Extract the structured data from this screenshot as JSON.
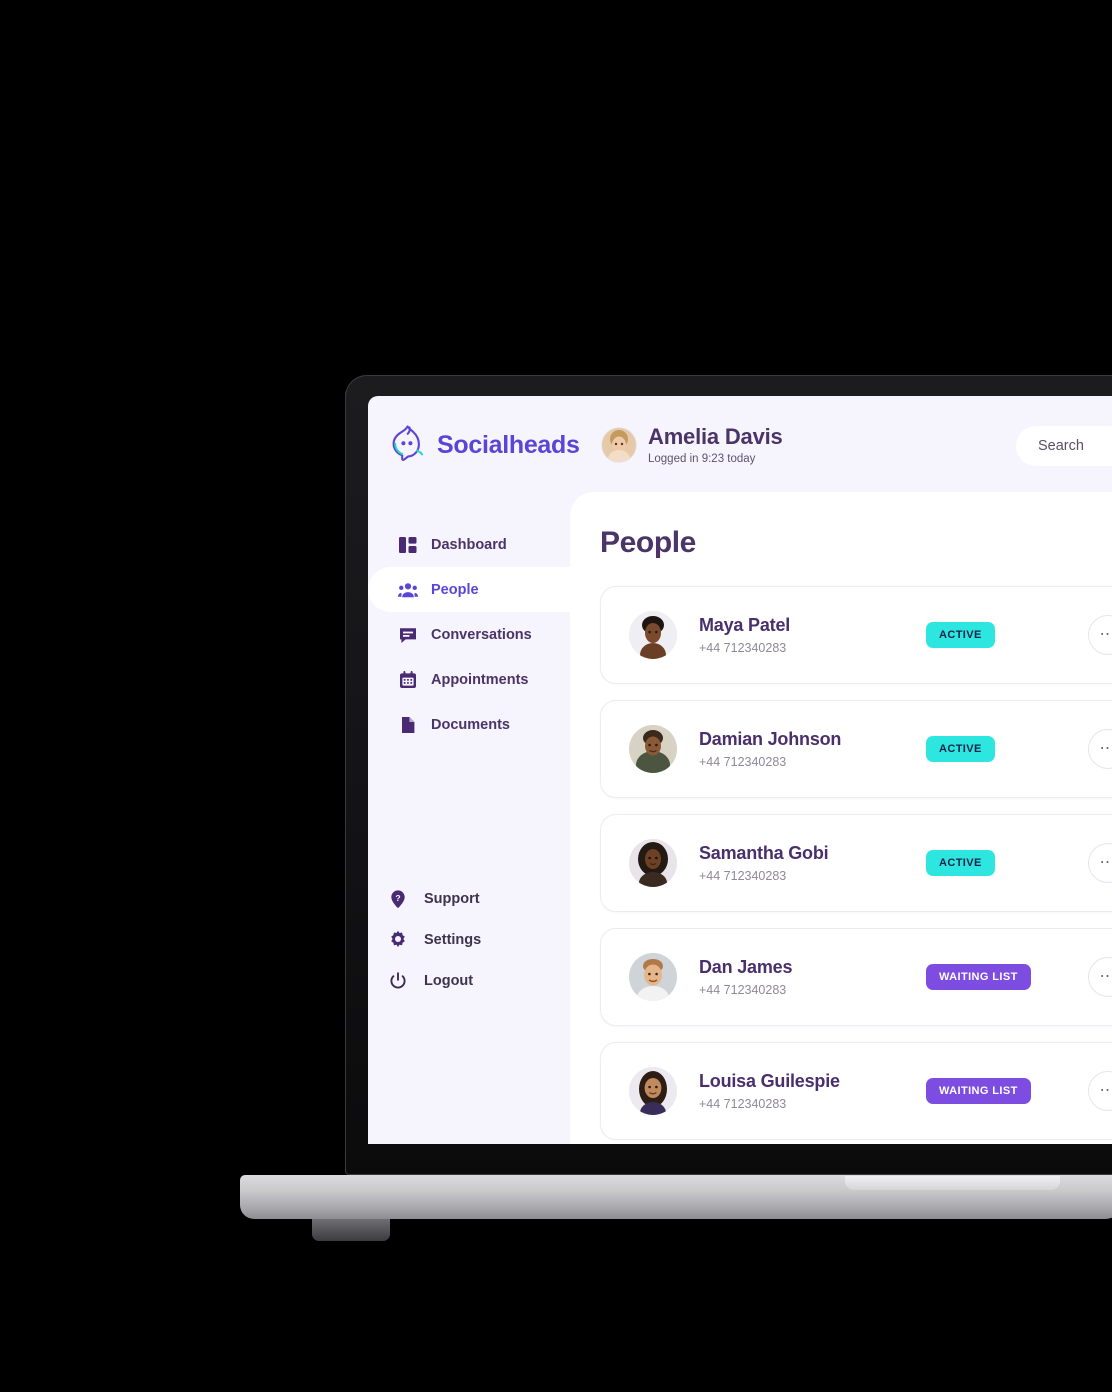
{
  "brand": {
    "name": "Socialheads",
    "logo_icon": "flame-speech-bubble-logo"
  },
  "header": {
    "user": {
      "name": "Amelia Davis",
      "status_line": "Logged in 9:23 today",
      "avatar_icon": "user-avatar"
    },
    "search": {
      "placeholder": "Search",
      "value": "",
      "icon": "search-icon"
    }
  },
  "sidebar": {
    "items": [
      {
        "label": "Dashboard",
        "icon": "dashboard-icon",
        "active": false
      },
      {
        "label": "People",
        "icon": "people-icon",
        "active": true
      },
      {
        "label": "Conversations",
        "icon": "chat-icon",
        "active": false
      },
      {
        "label": "Appointments",
        "icon": "calendar-icon",
        "active": false
      },
      {
        "label": "Documents",
        "icon": "document-icon",
        "active": false
      }
    ],
    "bottom_items": [
      {
        "label": "Support",
        "icon": "help-pin-icon"
      },
      {
        "label": "Settings",
        "icon": "gear-icon"
      },
      {
        "label": "Logout",
        "icon": "power-icon"
      }
    ]
  },
  "main": {
    "title": "People",
    "rows": [
      {
        "name": "Maya Patel",
        "phone": "+44 712340283",
        "status": "ACTIVE",
        "status_kind": "active",
        "avatar_icon": "person-avatar"
      },
      {
        "name": "Damian Johnson",
        "phone": "+44 712340283",
        "status": "ACTIVE",
        "status_kind": "active",
        "avatar_icon": "person-avatar"
      },
      {
        "name": "Samantha Gobi",
        "phone": "+44 712340283",
        "status": "ACTIVE",
        "status_kind": "active",
        "avatar_icon": "person-avatar"
      },
      {
        "name": "Dan James",
        "phone": "+44 712340283",
        "status": "WAITING LIST",
        "status_kind": "waiting",
        "avatar_icon": "person-avatar"
      },
      {
        "name": "Louisa Guilespie",
        "phone": "+44 712340283",
        "status": "WAITING LIST",
        "status_kind": "waiting",
        "avatar_icon": "person-avatar"
      }
    ],
    "row_action_icon": "more-options-icon",
    "row_action_glyph": "⋯"
  },
  "colors": {
    "brand_purple": "#5a45d6",
    "badge_active": "#2ee6e0",
    "badge_waiting": "#7c4de0",
    "heading": "#4a3468",
    "app_background": "#f6f4fd",
    "panel_background": "#ffffff"
  }
}
